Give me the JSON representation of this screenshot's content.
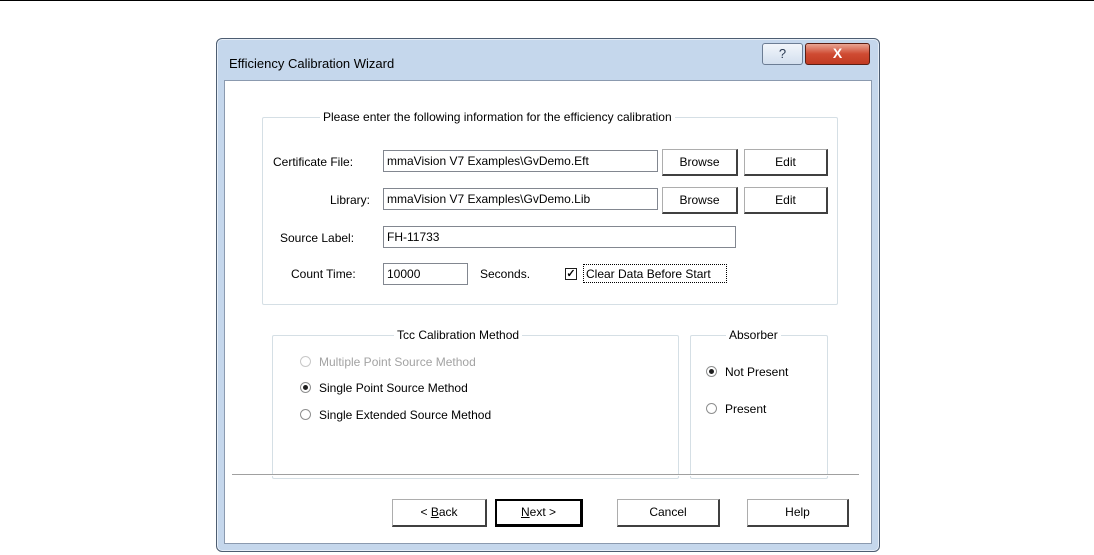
{
  "dialog": {
    "title": "Efficiency Calibration Wizard",
    "help_caption": "?",
    "close_caption": "X"
  },
  "info_group": {
    "legend": "Please enter the following information for the efficiency calibration",
    "certificate_label": "Certificate File:",
    "certificate_value": "mmaVision V7 Examples\\GvDemo.Eft",
    "library_label": "Library:",
    "library_value": "mmaVision V7 Examples\\GvDemo.Lib",
    "browse_label": "Browse",
    "edit_label": "Edit",
    "source_label": "Source Label:",
    "source_value": "FH-11733",
    "count_time_label": "Count Time:",
    "count_time_value": "10000",
    "seconds_label": "Seconds.",
    "clear_data_label": "Clear Data Before Start",
    "clear_data_checked": true
  },
  "tcc_group": {
    "legend": "Tcc Calibration Method",
    "options": [
      {
        "label": "Multiple Point Source Method",
        "checked": false,
        "disabled": true
      },
      {
        "label": "Single Point Source Method",
        "checked": true,
        "disabled": false
      },
      {
        "label": "Single Extended Source Method",
        "checked": false,
        "disabled": false
      }
    ]
  },
  "absorber_group": {
    "legend": "Absorber",
    "options": [
      {
        "label": "Not Present",
        "checked": true
      },
      {
        "label": "Present",
        "checked": false
      }
    ]
  },
  "footer": {
    "back_prefix": "< ",
    "back_mnemonic": "B",
    "back_rest": "ack",
    "next_mnemonic": "N",
    "next_rest": "ext >",
    "cancel_label": "Cancel",
    "help_label": "Help"
  }
}
